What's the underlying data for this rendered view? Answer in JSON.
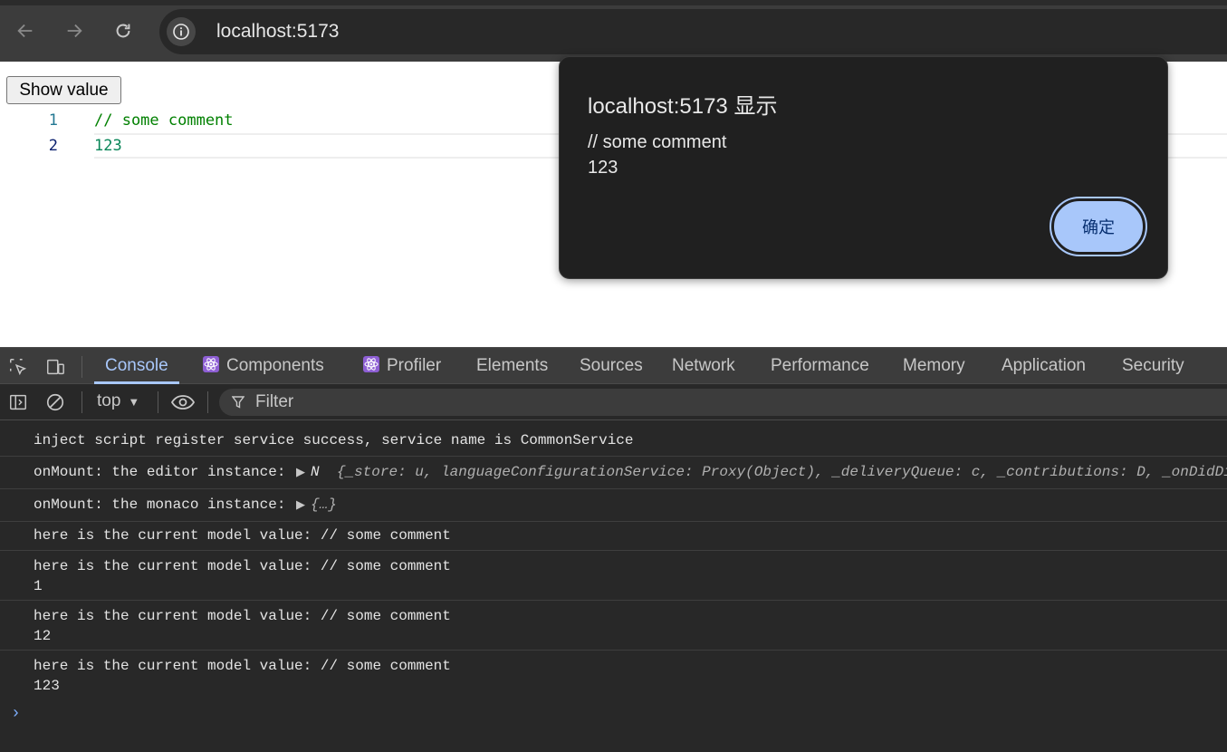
{
  "browser": {
    "url": "localhost:5173"
  },
  "page": {
    "show_button_label": "Show value",
    "editor_lines": [
      {
        "number": "1",
        "code": "// some comment"
      },
      {
        "number": "2",
        "code": "123"
      }
    ]
  },
  "dialog": {
    "title": "localhost:5173 显示",
    "message_line1": "// some comment",
    "message_line2": "123",
    "ok_label": "确定"
  },
  "devtools": {
    "tabs": [
      "Console",
      "Components",
      "Profiler",
      "Elements",
      "Sources",
      "Network",
      "Performance",
      "Memory",
      "Application",
      "Security"
    ],
    "context": "top",
    "filter_placeholder": "Filter",
    "messages": {
      "m1": "inject script register service success, service name is CommonService",
      "m2_prefix": "onMount: the editor instance: ",
      "m2_obj_name": "N",
      "m2_obj": "{_store: u, languageConfigurationService: Proxy(Object), _deliveryQueue: c, _contributions: D, _onDidDispose: F",
      "m3_prefix": "onMount: the monaco instance: ",
      "m3_obj": "{…}",
      "m4": "here is the current model value: // some comment",
      "m5a": "here is the current model value: // some comment",
      "m5b": "1",
      "m6a": "here is the current model value: // some comment",
      "m6b": "12",
      "m7a": "here is the current model value: // some comment",
      "m7b": "123"
    }
  },
  "colors": {
    "accent": "#a8c7fa",
    "comment_green": "#008000",
    "number_teal": "#098658"
  }
}
